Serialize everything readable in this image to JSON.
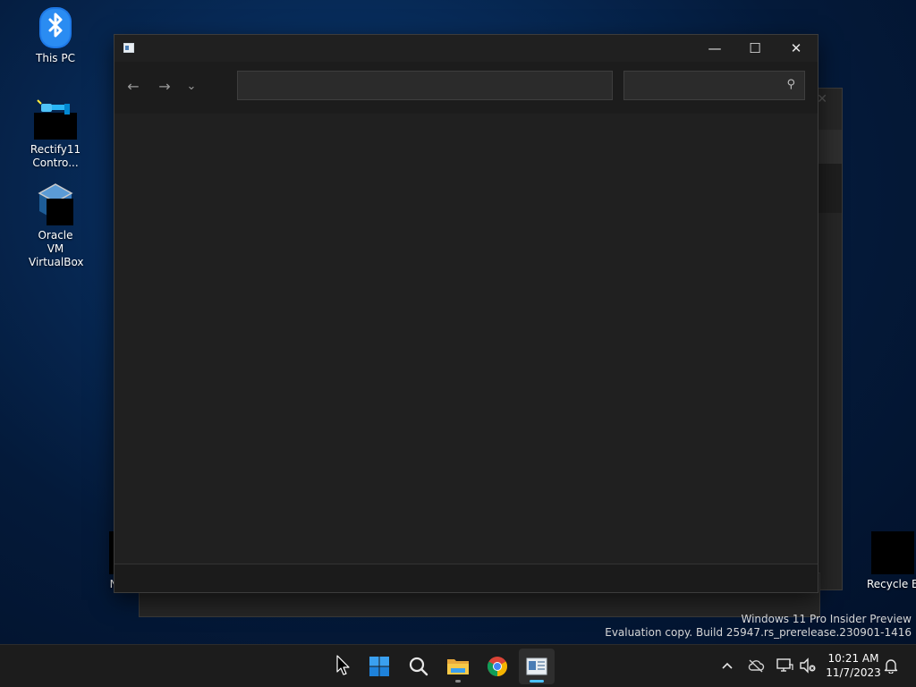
{
  "desktop": {
    "icons": [
      {
        "label": "This PC",
        "icon": "bluetooth-icon"
      },
      {
        "label": "Rectify11 Contro...",
        "icon": "control-panel-icon"
      },
      {
        "label": "Oracle VM VirtualBox",
        "icon": "virtualbox-icon"
      },
      {
        "label": "NC",
        "icon": "redacted-icon"
      },
      {
        "label": "Recycle Bi",
        "icon": "recycle-bin-icon"
      }
    ],
    "watermark": {
      "line1": "Windows 11 Pro Insider Preview",
      "line2": "Evaluation copy. Build 25947.rs_prerelease.230901-1416"
    }
  },
  "window": {
    "title": "",
    "caption": {
      "minimize": "—",
      "maximize": "☐",
      "close": "✕"
    },
    "nav": {
      "back": "←",
      "forward": "→",
      "recent": "⌄"
    },
    "address": {
      "value": "",
      "placeholder": ""
    },
    "search": {
      "value": "",
      "placeholder": "",
      "icon": "⚲"
    }
  },
  "taskbar": {
    "apps": [
      {
        "name": "start",
        "icon": "windows-logo-icon"
      },
      {
        "name": "search",
        "icon": "search-icon"
      },
      {
        "name": "file-explorer",
        "icon": "folder-icon"
      },
      {
        "name": "chrome",
        "icon": "chrome-icon"
      },
      {
        "name": "control-panel",
        "icon": "window-app-icon",
        "active": true
      }
    ],
    "tray": {
      "chevron": "^",
      "time": "10:21 AM",
      "date": "11/7/2023"
    }
  },
  "colors": {
    "accent": "#4cc2ff",
    "window_bg": "#202020",
    "taskbar_bg": "#1c1c1c"
  }
}
